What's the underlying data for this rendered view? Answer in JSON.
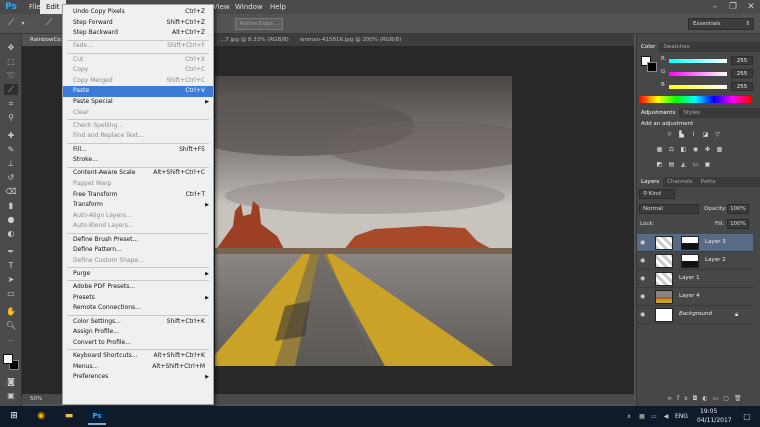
{
  "app": {
    "logo": "Ps"
  },
  "menubar": {
    "items": [
      {
        "label": "File"
      },
      {
        "label": "Edit"
      },
      {
        "label": "View"
      },
      {
        "label": "Window"
      },
      {
        "label": "Help"
      }
    ]
  },
  "optbar": {
    "refine_edge": "Refine Edge...",
    "workspace": "Essentials"
  },
  "tabs": [
    {
      "label": "RainbowCo..."
    },
    {
      "label": "...7.jpg @ 8.33% (RGB/8)"
    },
    {
      "label": "woman-415816.jpg @ 200% (RGB/8)"
    }
  ],
  "edit_menu": {
    "items": [
      {
        "label": "Undo Copy Pixels",
        "shortcut": "Ctrl+Z"
      },
      {
        "label": "Step Forward",
        "shortcut": "Shift+Ctrl+Z"
      },
      {
        "label": "Step Backward",
        "shortcut": "Alt+Ctrl+Z"
      },
      {
        "label": "Fade...",
        "shortcut": "Shift+Ctrl+F"
      },
      {
        "label": "Cut",
        "shortcut": "Ctrl+X"
      },
      {
        "label": "Copy",
        "shortcut": "Ctrl+C"
      },
      {
        "label": "Copy Merged",
        "shortcut": "Shift+Ctrl+C"
      },
      {
        "label": "Paste",
        "shortcut": "Ctrl+V"
      },
      {
        "label": "Paste Special",
        "shortcut": ""
      },
      {
        "label": "Clear",
        "shortcut": ""
      },
      {
        "label": "Check Spelling...",
        "shortcut": ""
      },
      {
        "label": "Find and Replace Text...",
        "shortcut": ""
      },
      {
        "label": "Fill...",
        "shortcut": "Shift+F5"
      },
      {
        "label": "Stroke...",
        "shortcut": ""
      },
      {
        "label": "Content-Aware Scale",
        "shortcut": "Alt+Shift+Ctrl+C"
      },
      {
        "label": "Puppet Warp",
        "shortcut": ""
      },
      {
        "label": "Free Transform",
        "shortcut": "Ctrl+T"
      },
      {
        "label": "Transform",
        "shortcut": ""
      },
      {
        "label": "Auto-Align Layers...",
        "shortcut": ""
      },
      {
        "label": "Auto-Blend Layers...",
        "shortcut": ""
      },
      {
        "label": "Define Brush Preset...",
        "shortcut": ""
      },
      {
        "label": "Define Pattern...",
        "shortcut": ""
      },
      {
        "label": "Define Custom Shape...",
        "shortcut": ""
      },
      {
        "label": "Purge",
        "shortcut": ""
      },
      {
        "label": "Adobe PDF Presets...",
        "shortcut": ""
      },
      {
        "label": "Presets",
        "shortcut": ""
      },
      {
        "label": "Remote Connections...",
        "shortcut": ""
      },
      {
        "label": "Color Settings...",
        "shortcut": "Shift+Ctrl+K"
      },
      {
        "label": "Assign Profile...",
        "shortcut": ""
      },
      {
        "label": "Convert to Profile...",
        "shortcut": ""
      },
      {
        "label": "Keyboard Shortcuts...",
        "shortcut": "Alt+Shift+Ctrl+K"
      },
      {
        "label": "Menus...",
        "shortcut": "Alt+Shift+Ctrl+M"
      },
      {
        "label": "Preferences",
        "shortcut": ""
      }
    ]
  },
  "color_panel": {
    "tabs": [
      "Color",
      "Swatches"
    ],
    "channels": [
      {
        "label": "R",
        "value": "255"
      },
      {
        "label": "G",
        "value": "255"
      },
      {
        "label": "B",
        "value": "255"
      }
    ]
  },
  "adjustments_panel": {
    "tabs": [
      "Adjustments",
      "Styles"
    ],
    "title": "Add an adjustment"
  },
  "layers_panel": {
    "tabs": [
      "Layers",
      "Channels",
      "Paths"
    ],
    "kind": "Kind",
    "blend_mode": "Normal",
    "opacity_label": "Opacity:",
    "opacity": "100%",
    "lock_label": "Lock:",
    "fill_label": "Fill:",
    "fill": "100%",
    "layers": [
      {
        "name": "Layer 3"
      },
      {
        "name": "Layer 2"
      },
      {
        "name": "Layer 1"
      },
      {
        "name": "Layer 4"
      },
      {
        "name": "Background"
      }
    ]
  },
  "status": {
    "zoom": "50%"
  },
  "taskbar": {
    "lang": "ENG",
    "time": "19:05",
    "date": "04/11/2017"
  },
  "colors": {
    "highlight": "#3d7bd6",
    "selected_layer": "#576b85",
    "ps_blue": "#31a8ff"
  }
}
